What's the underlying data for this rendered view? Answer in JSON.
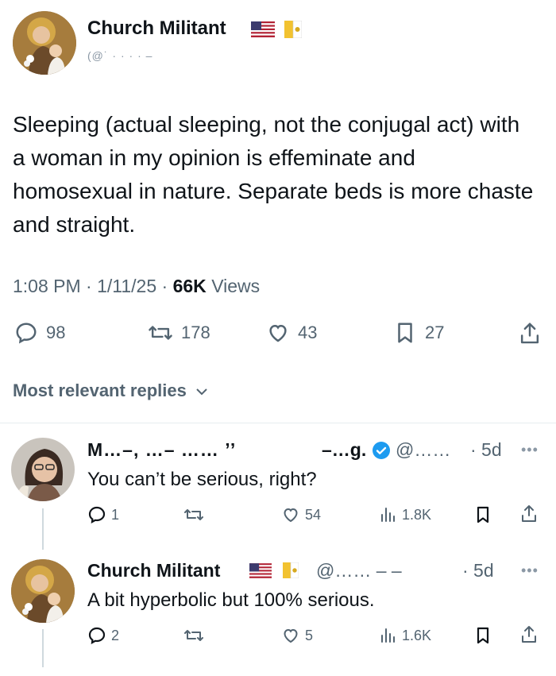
{
  "tweet": {
    "author_name": "Church Militant",
    "handle_obscured": "(@˙  ·          · · · –",
    "text": "Sleeping (actual sleeping, not the conjugal act) with a woman in my opinion is effeminate and homosexual in nature. Separate beds is more chaste and straight.",
    "time": "1:08 PM",
    "date": "1/11/25",
    "views_count": "66K",
    "views_label": "Views",
    "replies": "98",
    "reposts": "178",
    "likes": "43",
    "bookmarks": "27"
  },
  "replies_header": {
    "label": "Most relevant replies"
  },
  "replies": [
    {
      "author_name_obscured": "M…–, …– …… ’’",
      "author_tail_obscured": "–…g.",
      "handle_obscured": "@……",
      "age": "· 5d",
      "text": "You can’t be serious, right?",
      "replies": "1",
      "reposts": "",
      "likes": "54",
      "views": "1.8K"
    },
    {
      "author_name": "Church Militant",
      "handle_obscured": "@…… – –",
      "age": "· 5d",
      "text": "A bit hyperbolic but 100% serious.",
      "replies": "2",
      "reposts": "",
      "likes": "5",
      "views": "1.6K"
    }
  ],
  "colors": {
    "text": "#0f1419",
    "muted": "#536471",
    "verified": "#1d9bf0",
    "divider": "#e6ecf0"
  }
}
